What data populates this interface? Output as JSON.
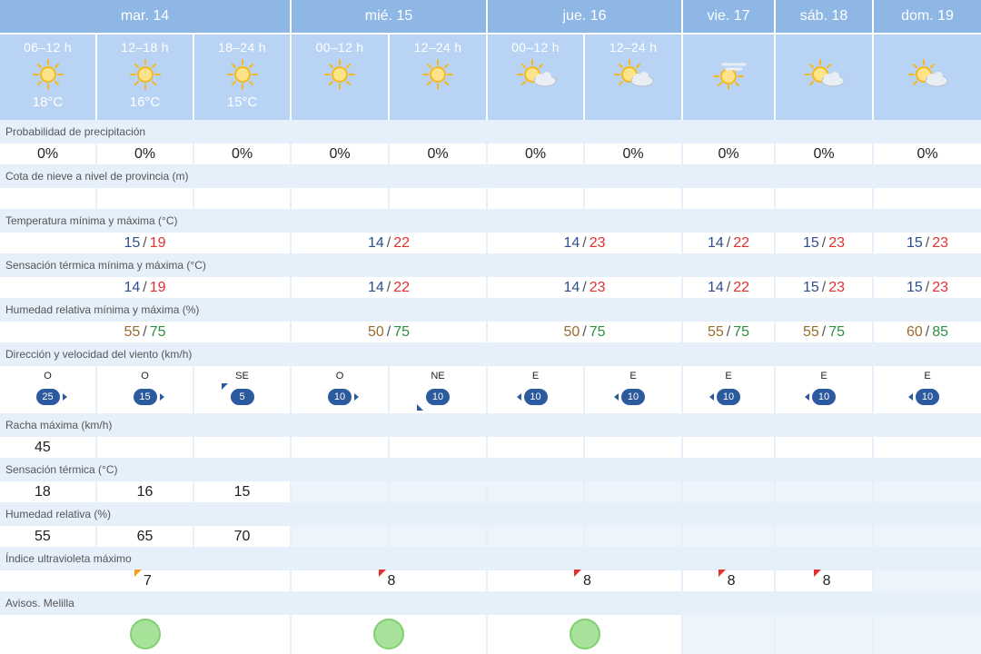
{
  "days": [
    {
      "label": "mar. 14"
    },
    {
      "label": "mié. 15"
    },
    {
      "label": "jue. 16"
    },
    {
      "label": "vie. 17"
    },
    {
      "label": "sáb. 18"
    },
    {
      "label": "dom. 19"
    }
  ],
  "periods": [
    {
      "label": "06–12 h",
      "icon": "sun-icon",
      "temp": "18°C"
    },
    {
      "label": "12–18 h",
      "icon": "sun-icon",
      "temp": "16°C"
    },
    {
      "label": "18–24 h",
      "icon": "sun-icon",
      "temp": "15°C"
    },
    {
      "label": "00–12 h",
      "icon": "sun-icon",
      "temp": ""
    },
    {
      "label": "12–24 h",
      "icon": "sun-icon",
      "temp": ""
    },
    {
      "label": "00–12 h",
      "icon": "sun-cloud-icon",
      "temp": ""
    },
    {
      "label": "12–24 h",
      "icon": "sun-cloud-icon",
      "temp": ""
    },
    {
      "label": "",
      "icon": "sun-haze-icon",
      "temp": ""
    },
    {
      "label": "",
      "icon": "sun-cloud-icon",
      "temp": ""
    },
    {
      "label": "",
      "icon": "sun-cloud-icon",
      "temp": ""
    }
  ],
  "labels": {
    "precip": "Probabilidad de precipitación",
    "snow": "Cota de nieve a nivel de provincia (m)",
    "temp": "Temperatura mínima y máxima (°C)",
    "feels": "Sensación térmica mínima y máxima (°C)",
    "humidity": "Humedad relativa mínima y máxima (%)",
    "wind": "Dirección y velocidad del viento (km/h)",
    "gust": "Racha máxima (km/h)",
    "feels_now": "Sensación térmica (°C)",
    "hum_now": "Humedad relativa (%)",
    "uv": "Índice ultravioleta máximo",
    "alerts": "Avisos. Melilla"
  },
  "precip": [
    "0%",
    "0%",
    "0%",
    "0%",
    "0%",
    "0%",
    "0%",
    "0%",
    "0%",
    "0%"
  ],
  "temp": [
    {
      "min": "15",
      "max": "19"
    },
    {
      "min": "14",
      "max": "22"
    },
    {
      "min": "14",
      "max": "23"
    },
    {
      "min": "14",
      "max": "22"
    },
    {
      "min": "15",
      "max": "23"
    },
    {
      "min": "15",
      "max": "23"
    }
  ],
  "feels": [
    {
      "min": "14",
      "max": "19"
    },
    {
      "min": "14",
      "max": "22"
    },
    {
      "min": "14",
      "max": "23"
    },
    {
      "min": "14",
      "max": "22"
    },
    {
      "min": "15",
      "max": "23"
    },
    {
      "min": "15",
      "max": "23"
    }
  ],
  "humidity": [
    {
      "min": "55",
      "max": "75"
    },
    {
      "min": "50",
      "max": "75"
    },
    {
      "min": "50",
      "max": "75"
    },
    {
      "min": "55",
      "max": "75"
    },
    {
      "min": "55",
      "max": "75"
    },
    {
      "min": "60",
      "max": "85"
    }
  ],
  "wind": [
    {
      "dir": "O",
      "speed": "25"
    },
    {
      "dir": "O",
      "speed": "15"
    },
    {
      "dir": "SE",
      "speed": "5"
    },
    {
      "dir": "O",
      "speed": "10"
    },
    {
      "dir": "NE",
      "speed": "10"
    },
    {
      "dir": "E",
      "speed": "10"
    },
    {
      "dir": "E",
      "speed": "10"
    },
    {
      "dir": "E",
      "speed": "10"
    },
    {
      "dir": "E",
      "speed": "10"
    },
    {
      "dir": "E",
      "speed": "10"
    }
  ],
  "gust": [
    "45"
  ],
  "feels_now": [
    "18",
    "16",
    "15"
  ],
  "hum_now": [
    "55",
    "65",
    "70"
  ],
  "uv": [
    "7",
    "8",
    "8",
    "8",
    "8"
  ],
  "colors": {
    "header_bg": "#8eb7e6",
    "period_bg": "#b9d3f4",
    "label_bg": "#e6f0fb",
    "min_color": "#2e4f8f",
    "max_color": "#e03030",
    "wind_badge": "#2c5a9e",
    "uv_high": "#e53030",
    "uv_moderate": "#f0a020",
    "alert_green": "#a7e29a"
  }
}
